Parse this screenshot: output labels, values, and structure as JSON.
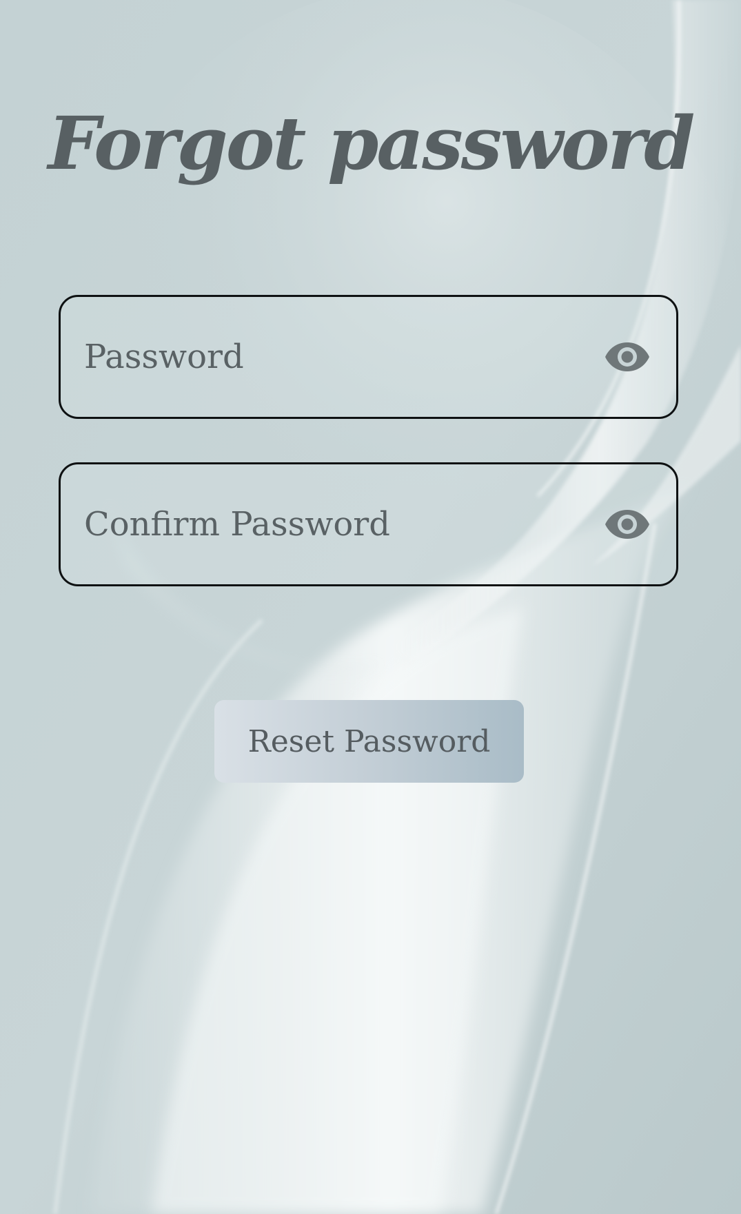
{
  "page": {
    "title": "Forgot password"
  },
  "form": {
    "password": {
      "value": "",
      "placeholder": "Password",
      "toggle_icon": "eye-icon"
    },
    "confirm_password": {
      "value": "",
      "placeholder": "Confirm Password",
      "toggle_icon": "eye-icon"
    },
    "submit_label": "Reset Password"
  },
  "colors": {
    "background": "#c2d0d2",
    "text": "#586063",
    "field_border": "#0e1112",
    "icon": "#6f7779",
    "button_gradient_start": "#d9e0e6",
    "button_gradient_end": "#a9bcc7"
  }
}
